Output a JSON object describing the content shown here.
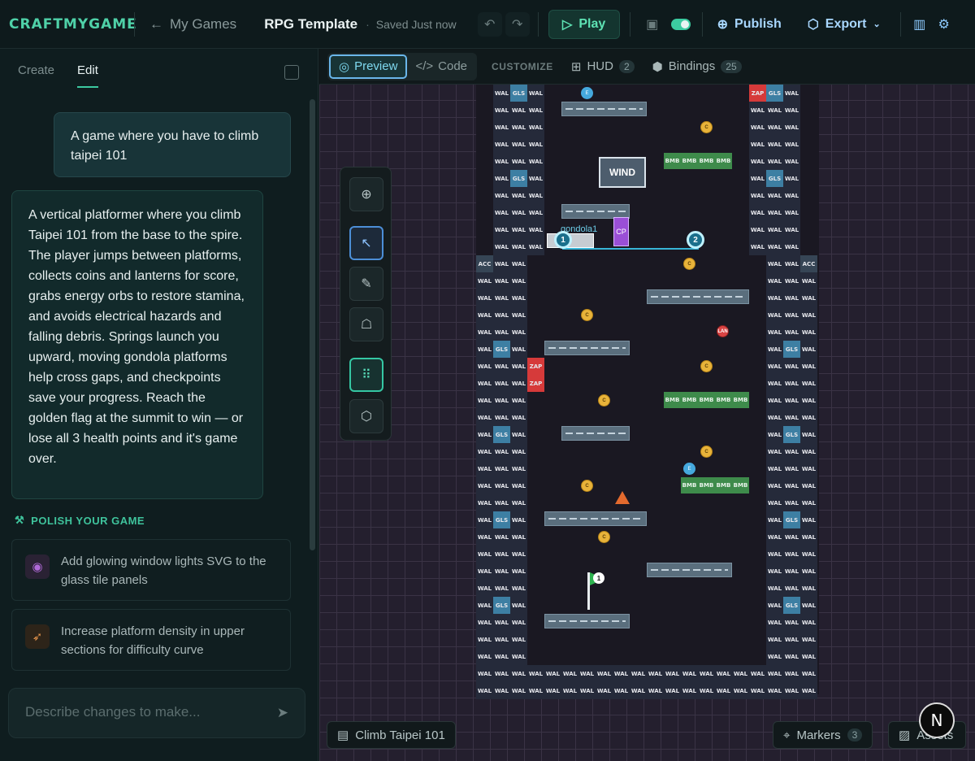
{
  "header": {
    "logo": "CRAFTMYGAME",
    "back_label": "My Games",
    "project_title": "RPG Template",
    "saved_status": "Saved Just now",
    "play_label": "Play",
    "publish_label": "Publish",
    "export_label": "Export"
  },
  "sidebar": {
    "tabs": [
      "Create",
      "Edit"
    ],
    "active_tab": "Edit",
    "user_message": "A game where you have to climb taipei 101",
    "ai_message": "A vertical platformer where you climb Taipei 101 from the base to the spire. The player jumps between platforms, collects coins and lanterns for score, grabs energy orbs to restore stamina, and avoids electrical hazards and falling debris. Springs launch you upward, moving gondola platforms help cross gaps, and checkpoints save your progress. Reach the golden flag at the summit to win — or lose all 3 health points and it's game over.",
    "polish_heading": "POLISH YOUR GAME",
    "suggestions": [
      {
        "text": "Add glowing window lights SVG to the glass tile panels",
        "icon": "palette-icon",
        "color": "#b06ad8"
      },
      {
        "text": "Increase platform density in upper sections for difficulty curve",
        "icon": "rocket-icon",
        "color": "#e0914a"
      }
    ],
    "input_placeholder": "Describe changes to make..."
  },
  "canvas": {
    "view_tabs": [
      "Preview",
      "Code"
    ],
    "active_view": "Preview",
    "customize_label": "CUSTOMIZE",
    "hud_label": "HUD",
    "hud_count": "2",
    "bindings_label": "Bindings",
    "bindings_count": "25",
    "map_name": "Climb Taipei 101",
    "markers_label": "Markers",
    "markers_count": "3",
    "assets_label": "Assets",
    "gondola_label": "gondola1",
    "wind_label": "WIND",
    "checkpoint_label": "CP",
    "tile_labels": {
      "wall": "WAL",
      "glass": "GLS",
      "access": "ACC",
      "zap": "ZAP",
      "bomb": "BMB",
      "coin": "C",
      "orb": "E",
      "lantern": "LAN"
    },
    "path_points": [
      "1",
      "2"
    ],
    "flag_number": "1",
    "nextjs_badge": "N"
  },
  "colors": {
    "accent": "#3cc9a0",
    "publish": "#a8d7ff",
    "wall": "#252a3a",
    "glass": "#3d7fa3",
    "zap": "#d63a3a",
    "bomb": "#3e8b4b",
    "coin": "#e8b33a"
  }
}
